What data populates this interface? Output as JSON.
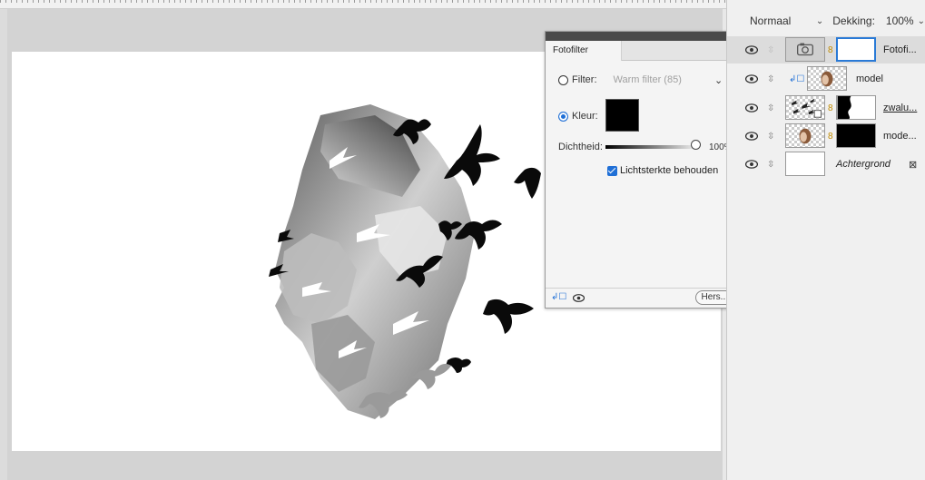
{
  "layers_panel": {
    "blend_mode": "Normaal",
    "opacity_label": "Dekking:",
    "opacity_value": "100%",
    "layers": [
      {
        "name": "Fotofi...",
        "selected": true
      },
      {
        "name": "model",
        "selected": false
      },
      {
        "name": "zwalu...",
        "selected": false
      },
      {
        "name": "mode...",
        "selected": false
      },
      {
        "name": "Achtergrond",
        "selected": false
      }
    ]
  },
  "properties_panel": {
    "tab_label": "Fotofilter",
    "filter_label": "Filter:",
    "filter_value": "Warm filter (85)",
    "color_label": "Kleur:",
    "color_value": "#000000",
    "density_label": "Dichtheid:",
    "density_value": "100%",
    "preserve_label": "Lichtsterkte behouden",
    "reset_label": "Hers..."
  },
  "icons": {
    "visibility": "eye-icon",
    "link": "link-icon",
    "close": "close-icon",
    "panel_menu": "panel-menu-icon",
    "clip": "clip-to-layer-icon",
    "lock": "lock-icon",
    "camera": "photo-filter-adjustment-icon"
  },
  "colors": {
    "accent": "#1f6fd6",
    "chain": "#c08a00"
  }
}
